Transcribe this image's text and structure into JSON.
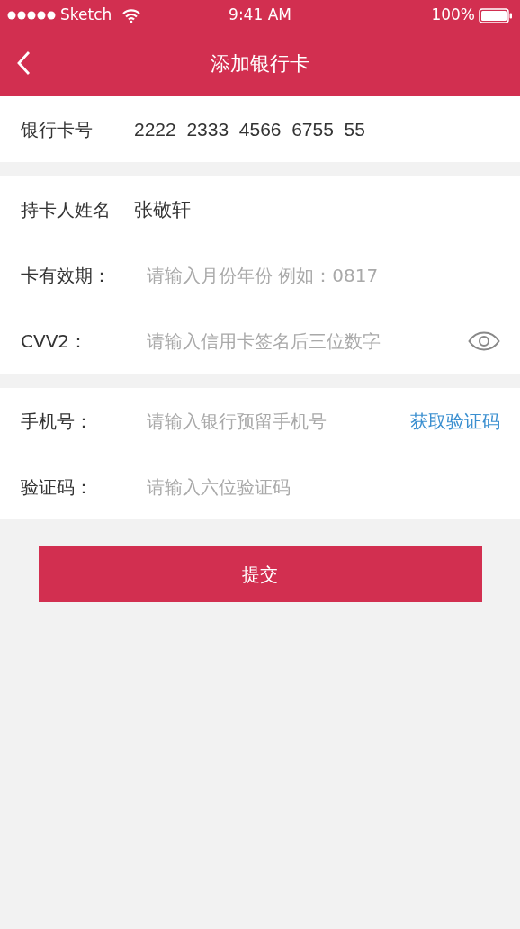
{
  "status_bar": {
    "carrier": "Sketch",
    "time": "9:41 AM",
    "battery": "100%"
  },
  "nav": {
    "title": "添加银行卡"
  },
  "sections": [
    {
      "rows": [
        {
          "kind": "value",
          "label": "银行卡号",
          "value": "2222  2333  4566  6755  55"
        }
      ]
    },
    {
      "rows": [
        {
          "kind": "value",
          "label": "持卡人姓名",
          "value": "张敬轩"
        },
        {
          "kind": "field",
          "label": "卡有效期：",
          "placeholder": "请输入月份年份 例如：0817"
        },
        {
          "kind": "field",
          "label": "CVV2：",
          "placeholder": "请输入信用卡签名后三位数字",
          "trailing": {
            "kind": "eye"
          }
        }
      ]
    },
    {
      "rows": [
        {
          "kind": "field",
          "label": "手机号：",
          "placeholder": "请输入银行预留手机号",
          "trailing": {
            "kind": "link",
            "label": "获取验证码"
          }
        },
        {
          "kind": "field",
          "label": "验证码：",
          "placeholder": "请输入六位验证码"
        }
      ]
    }
  ],
  "submit": {
    "label": "提交"
  }
}
